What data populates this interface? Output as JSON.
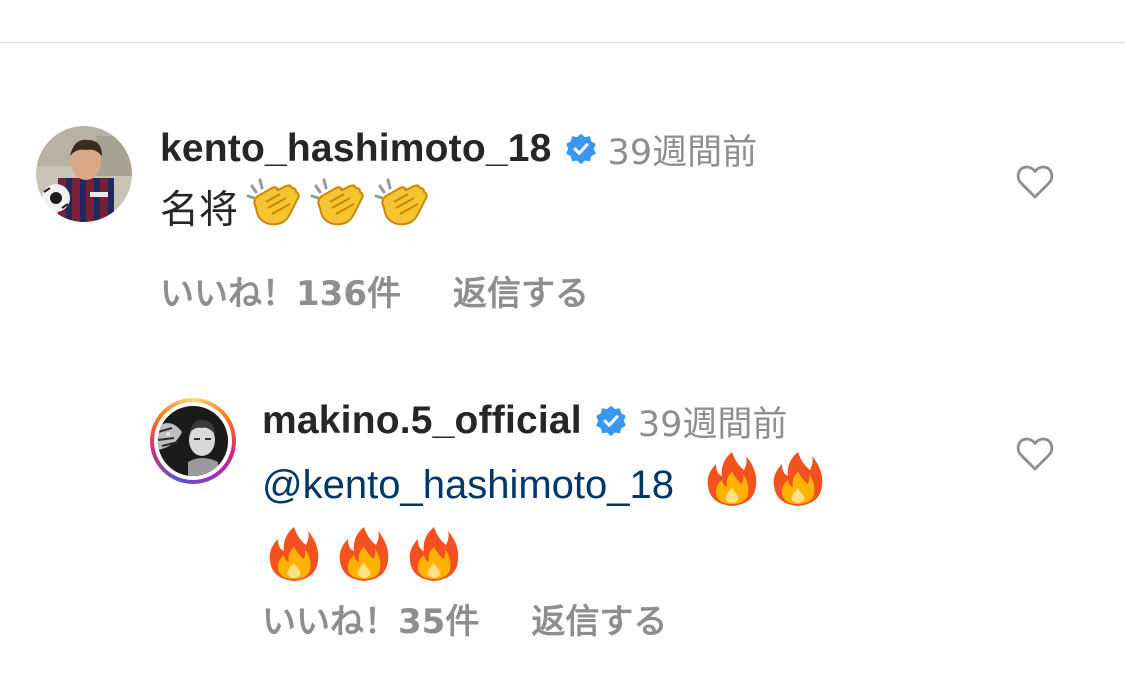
{
  "comments": [
    {
      "username": "kento_hashimoto_18",
      "verified": true,
      "time": "39週間前",
      "text": "名将",
      "emoji": [
        "clapping-hands",
        "clapping-hands",
        "clapping-hands"
      ],
      "likes": "いいね！136件",
      "reply": "返信する"
    },
    {
      "username": "makino.5_official",
      "verified": true,
      "time": "39週間前",
      "mention": "@kento_hashimoto_18",
      "emoji": [
        "fire",
        "fire",
        "fire",
        "fire",
        "fire"
      ],
      "likes": "いいね！35件",
      "reply": "返信する"
    }
  ],
  "colors": {
    "text": "#262626",
    "secondary": "#8e8e8e",
    "mention": "#00376b",
    "verified": "#3897f0",
    "divider": "#dbdbdb"
  },
  "icons": {
    "verified": "verified-badge-icon",
    "like": "heart-outline-icon"
  }
}
